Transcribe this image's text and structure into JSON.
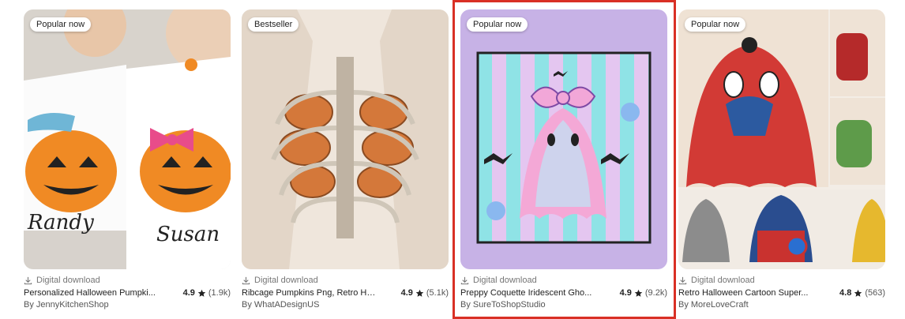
{
  "cards": [
    {
      "badge": "Popular now",
      "download_label": "Digital download",
      "title": "Personalized Halloween Pumpki...",
      "rating": "4.9",
      "reviews": "(1.9k)",
      "shop": "By JennyKitchenShop",
      "image_text": [
        "Randy",
        "Susan"
      ]
    },
    {
      "badge": "Bestseller",
      "download_label": "Digital download",
      "title": "Ribcage Pumpkins Png, Retro Ha...",
      "rating": "4.9",
      "reviews": "(5.1k)",
      "shop": "By WhatADesignUS"
    },
    {
      "badge": "Popular now",
      "download_label": "Digital download",
      "title": "Preppy Coquette Iridescent Gho...",
      "rating": "4.9",
      "reviews": "(9.2k)",
      "shop": "By SureToShopStudio"
    },
    {
      "badge": "Popular now",
      "download_label": "Digital download",
      "title": "Retro Halloween Cartoon Super...",
      "rating": "4.8",
      "reviews": "(563)",
      "shop": "By MoreLoveCraft"
    }
  ],
  "colors": {
    "highlight": "#d93025",
    "pumpkin": "#f08a24",
    "lavender": "#c7b2e6",
    "cream": "#efe6dc"
  }
}
